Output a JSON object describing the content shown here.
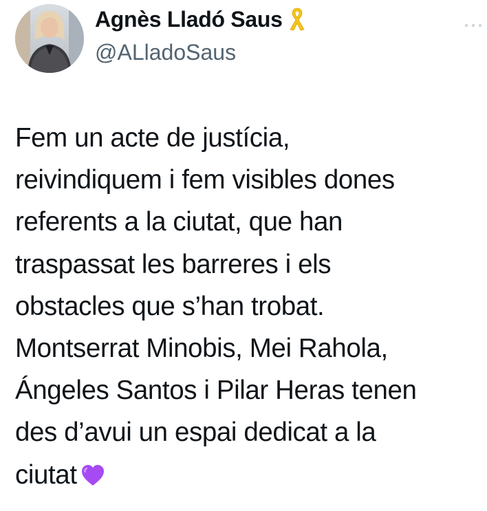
{
  "tweet": {
    "author": {
      "display_name": "Agnès Lladó Saus",
      "badge_icon": "yellow-ribbon-icon",
      "handle": "@ALladoSaus",
      "avatar_icon": "avatar-photo"
    },
    "menu_icon": "more-options-icon",
    "body": "Fem un acte de justícia,\nreivindiquem i fem visibles dones\nreferents a la ciutat, que han\ntraspassat les barreres i els\nobstacles que s’han trobat.\nMontserrat Minobis, Mei Rahola,\nÁngeles Santos i Pilar Heras tenen\ndes d’avui un espai dedicat a la\nciutat",
    "trailing_emoji_icon": "purple-heart-icon"
  },
  "colors": {
    "text": "#0f1419",
    "secondary_text": "#536471",
    "ribbon": "#f5c518",
    "heart": "#a64bf4"
  }
}
